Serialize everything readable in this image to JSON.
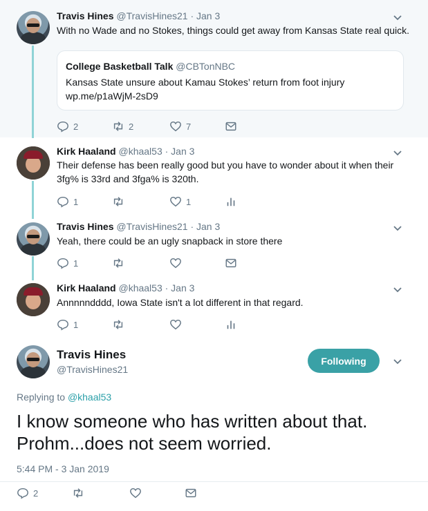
{
  "tweets": [
    {
      "name": "Travis Hines",
      "handle": "@TravisHines21 · Jan 3",
      "text": "With no Wade and no Stokes, things could get away from Kansas State real quick.",
      "quote": {
        "name": "College Basketball Talk",
        "handle": "@CBTonNBC",
        "text_line1": "Kansas State unsure about Kamau Stokes’ return from foot injury",
        "text_line2": "wp.me/p1aWjM-2sD9"
      },
      "replies": "2",
      "retweets": "2",
      "likes": "7"
    },
    {
      "name": "Kirk Haaland",
      "handle": "@khaal53 · Jan 3",
      "text": "Their defense has been really good but you have to wonder about it when their 3fg% is 33rd and 3fga% is 320th.",
      "replies": "1",
      "retweets": "",
      "likes": "1"
    },
    {
      "name": "Travis Hines",
      "handle": "@TravisHines21 · Jan 3",
      "text": "Yeah, there could be an ugly snapback in store there",
      "replies": "1",
      "retweets": "",
      "likes": ""
    },
    {
      "name": "Kirk Haaland",
      "handle": "@khaal53 · Jan 3",
      "text": "Annnnndddd, Iowa State isn't a lot different in that regard.",
      "replies": "1",
      "retweets": "",
      "likes": ""
    }
  ],
  "main_tweet": {
    "name": "Travis Hines",
    "handle": "@TravisHines21",
    "follow_label": "Following",
    "replying_prefix": "Replying to ",
    "replying_handle": "@khaal53",
    "text": "I know someone who has written about that. Prohm...does not seem worried.",
    "timestamp": "5:44 PM - 3 Jan 2019",
    "replies": "2"
  },
  "colors": {
    "accent": "#3aa1a6",
    "highlight_bg": "#f5f8fa",
    "secondary_text": "#657786"
  },
  "icons": [
    "chevron-down-icon",
    "reply-icon",
    "retweet-icon",
    "like-icon",
    "dm-icon",
    "analytics-icon"
  ]
}
